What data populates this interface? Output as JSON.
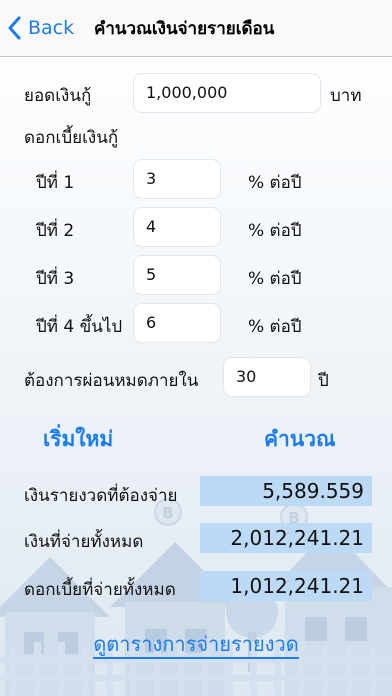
{
  "nav": {
    "back_label": "Back",
    "title": "คำนวณเงินจ่ายรายเดือน"
  },
  "form": {
    "loan_label": "ยอดเงินกู้",
    "loan_value": "1,000,000",
    "loan_unit": "บาท",
    "interest_label": "ดอกเบี้ยเงินกู้",
    "years": [
      {
        "label": "ปีที่ 1",
        "value": "3",
        "unit": "% ต่อปี"
      },
      {
        "label": "ปีที่ 2",
        "value": "4",
        "unit": "% ต่อปี"
      },
      {
        "label": "ปีที่ 3",
        "value": "5",
        "unit": "% ต่อปี"
      },
      {
        "label": "ปีที่ 4 ขึ้นไป",
        "value": "6",
        "unit": "% ต่อปี"
      }
    ],
    "term_label": "ต้องการผ่อนหมดภายใน",
    "term_value": "30",
    "term_unit": "ปี"
  },
  "actions": {
    "reset_label": "เริ่มใหม่",
    "calculate_label": "คำนวณ"
  },
  "results": [
    {
      "label": "เงินรายงวดที่ต้องจ่าย",
      "value": "5,589.559"
    },
    {
      "label": "เงินที่จ่ายทั้งหมด",
      "value": "2,012,241.21"
    },
    {
      "label": "ดอกเบี้ยที่จ่ายทั้งหมด",
      "value": "1,012,241.21"
    }
  ],
  "schedule_link": "ดูตารางการจ่ายรายงวด",
  "icons": {
    "back": "chevron-left-icon",
    "coin": "baht-coin-icon",
    "house": "house-icon",
    "tree": "tree-icon"
  },
  "colors": {
    "accent": "#1a7cf5",
    "result_box": "#bcdaf6"
  }
}
